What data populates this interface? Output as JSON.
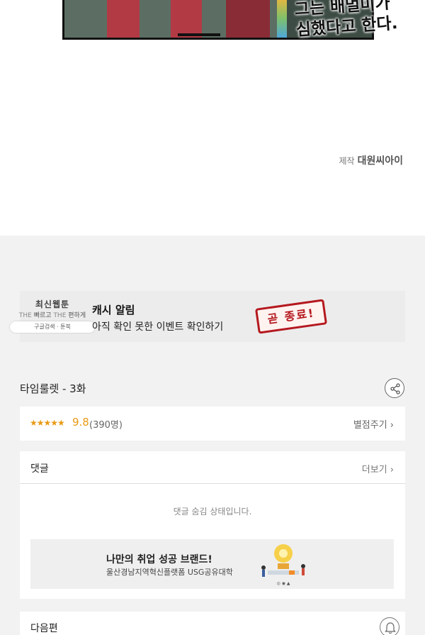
{
  "comic": {
    "lines": [
      "그는 배멀미가",
      "심했다고 한다."
    ],
    "credit_label": "제작",
    "credit_studio": "대원씨아이"
  },
  "banner": {
    "logo_line1": "최신웹툰",
    "logo_line2a": "THE",
    "logo_line2b": "빠르고",
    "logo_line2c": "THE",
    "logo_line2d": "편하게",
    "pill_text": "구글검색  ·  툰북",
    "title": "캐시 알림",
    "subtitle": "아직 확인 못한 이벤트 확인하기",
    "stamp_text": "곧 종료!",
    "accent": "#b4191f"
  },
  "episode": {
    "title": "타임룰렛 - 3화",
    "share_icon": "share-icon"
  },
  "rating": {
    "stars": "★★★★★",
    "score": "9.8",
    "count": "(390명)",
    "rate_label": "별점주기 ›",
    "star_color": "#e89a16"
  },
  "comments": {
    "title": "댓글",
    "more_label": "더보기 ›",
    "hidden_message": "댓글 숨김 상태입니다."
  },
  "ad": {
    "title": "나만의 취업 성공 브랜드!",
    "subtitle": "울산경남지역혁신플랫폼 USG공유대학"
  },
  "next": {
    "title": "다음편",
    "bell_icon": "bell-icon"
  }
}
